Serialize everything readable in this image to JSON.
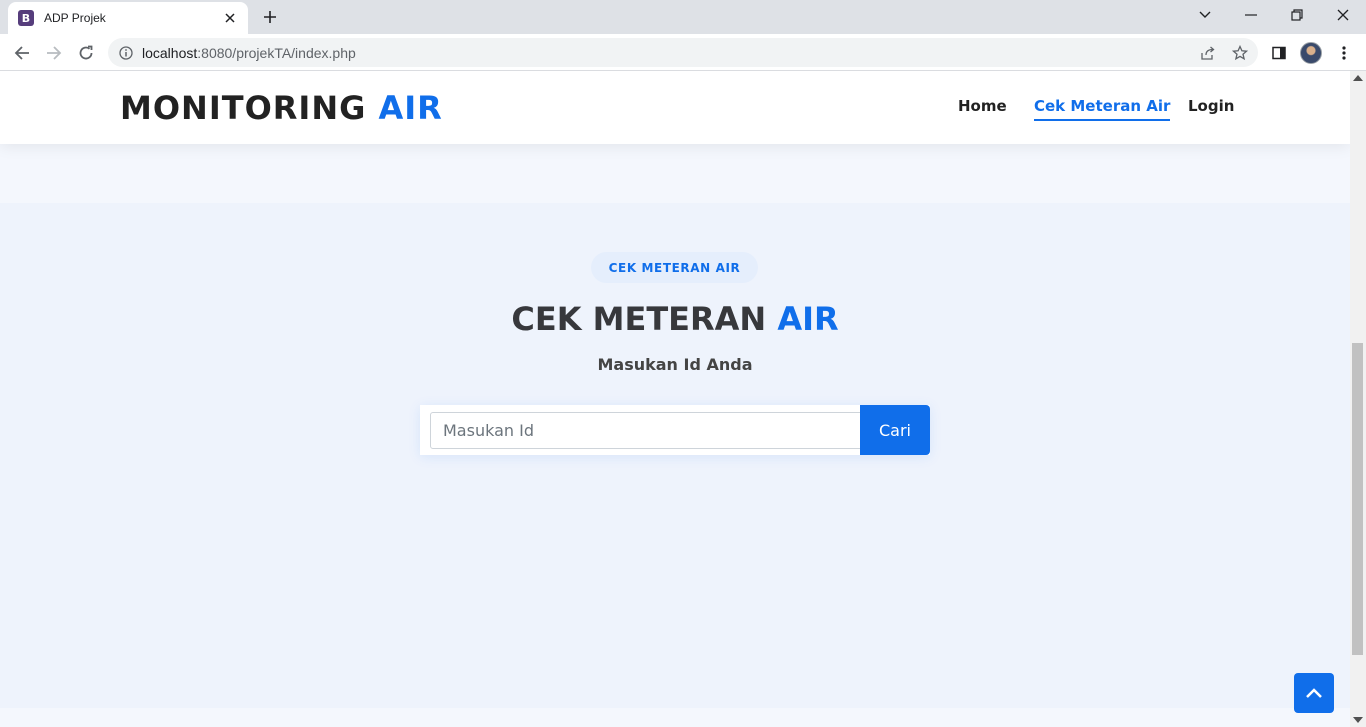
{
  "browser": {
    "tab_title": "ADP Projek",
    "tab_favicon_letter": "B",
    "url_host": "localhost",
    "url_rest": ":8080/projekTA/index.php"
  },
  "header": {
    "logo_main": "MONITORING ",
    "logo_accent": "AIR",
    "nav": [
      {
        "label": "Home",
        "active": false
      },
      {
        "label": "Cek Meteran Air",
        "active": true
      },
      {
        "label": "Login",
        "active": false
      }
    ]
  },
  "section": {
    "pill": "CEK METERAN AIR",
    "title_main": "CEK METERAN ",
    "title_accent": "AIR",
    "subtitle": "Masukan Id Anda",
    "input_placeholder": "Masukan Id",
    "input_value": "",
    "submit_label": "Cari"
  },
  "colors": {
    "accent": "#106eea",
    "section_bg": "#eef3fc",
    "page_bg": "#f4f7fd"
  },
  "icons": {
    "favicon": "bootstrap-icon",
    "back_to_top": "arrow-up-icon"
  }
}
